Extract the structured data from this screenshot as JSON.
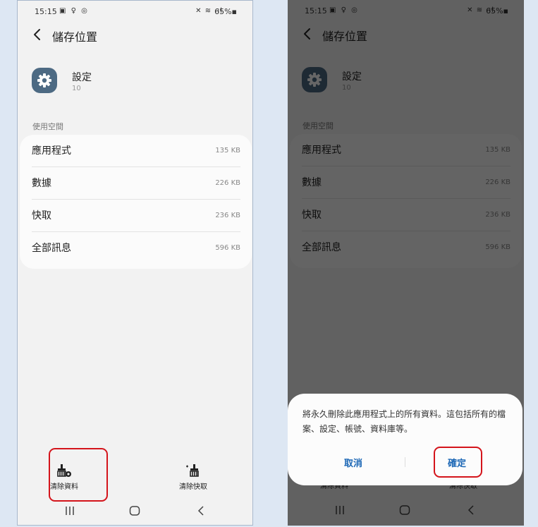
{
  "screen": {
    "status_bar": {
      "time": "15:15",
      "left_icons": "▣ ♀ ◎",
      "right_icons": "✕ ≋ .ıl",
      "battery": "65%▪"
    },
    "header": {
      "title": "儲存位置"
    },
    "app": {
      "name": "設定",
      "version": "10"
    },
    "section_label": "使用空間",
    "storage_rows": [
      {
        "label": "應用程式",
        "value": "135 KB"
      },
      {
        "label": "數據",
        "value": "226 KB"
      },
      {
        "label": "快取",
        "value": "236 KB"
      },
      {
        "label": "全部訊息",
        "value": "596 KB"
      }
    ],
    "bottom_actions": {
      "clear_data": "清除資料",
      "clear_cache": "清除快取"
    }
  },
  "dialog": {
    "message": "將永久刪除此應用程式上的所有資料。這包括所有的檔案、設定、帳號、資料庫等。",
    "cancel": "取消",
    "confirm": "確定"
  },
  "colors": {
    "highlight": "#d4141b",
    "dialog_button": "#1a66b5",
    "app_icon_bg": "#4d6a83"
  }
}
